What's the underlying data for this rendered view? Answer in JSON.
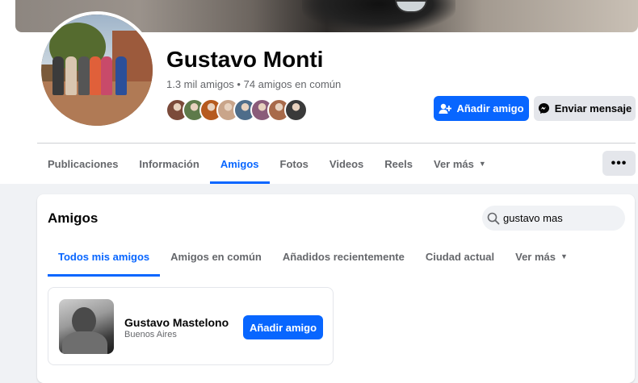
{
  "profile": {
    "name": "Gustavo Monti",
    "friends_meta": "1.3 mil amigos • 74 amigos en común",
    "mutual_avatar_colors": [
      "#7b4a3a",
      "#5e7a4a",
      "#b65a1e",
      "#c9a58a",
      "#4e6d8a",
      "#8a5c7a",
      "#a86a4a",
      "#3a3a3a"
    ]
  },
  "actions": {
    "add_friend": "Añadir amigo",
    "send_message": "Enviar mensaje"
  },
  "tabs": [
    {
      "label": "Publicaciones",
      "active": false
    },
    {
      "label": "Información",
      "active": false
    },
    {
      "label": "Amigos",
      "active": true
    },
    {
      "label": "Fotos",
      "active": false
    },
    {
      "label": "Videos",
      "active": false
    },
    {
      "label": "Reels",
      "active": false
    },
    {
      "label": "Ver más",
      "active": false
    }
  ],
  "friends_section": {
    "title": "Amigos",
    "search_value": "gustavo mas",
    "subtabs": [
      {
        "label": "Todos mis amigos",
        "active": true
      },
      {
        "label": "Amigos en común",
        "active": false
      },
      {
        "label": "Añadidos recientemente",
        "active": false
      },
      {
        "label": "Ciudad actual",
        "active": false
      },
      {
        "label": "Ver más",
        "active": false
      }
    ],
    "results": [
      {
        "name": "Gustavo Mastelono",
        "location": "Buenos Aires",
        "button": "Añadir amigo"
      }
    ]
  },
  "colors": {
    "accent": "#0866ff",
    "secondary_button": "#e4e6eb",
    "page_bg": "#f0f2f5"
  }
}
